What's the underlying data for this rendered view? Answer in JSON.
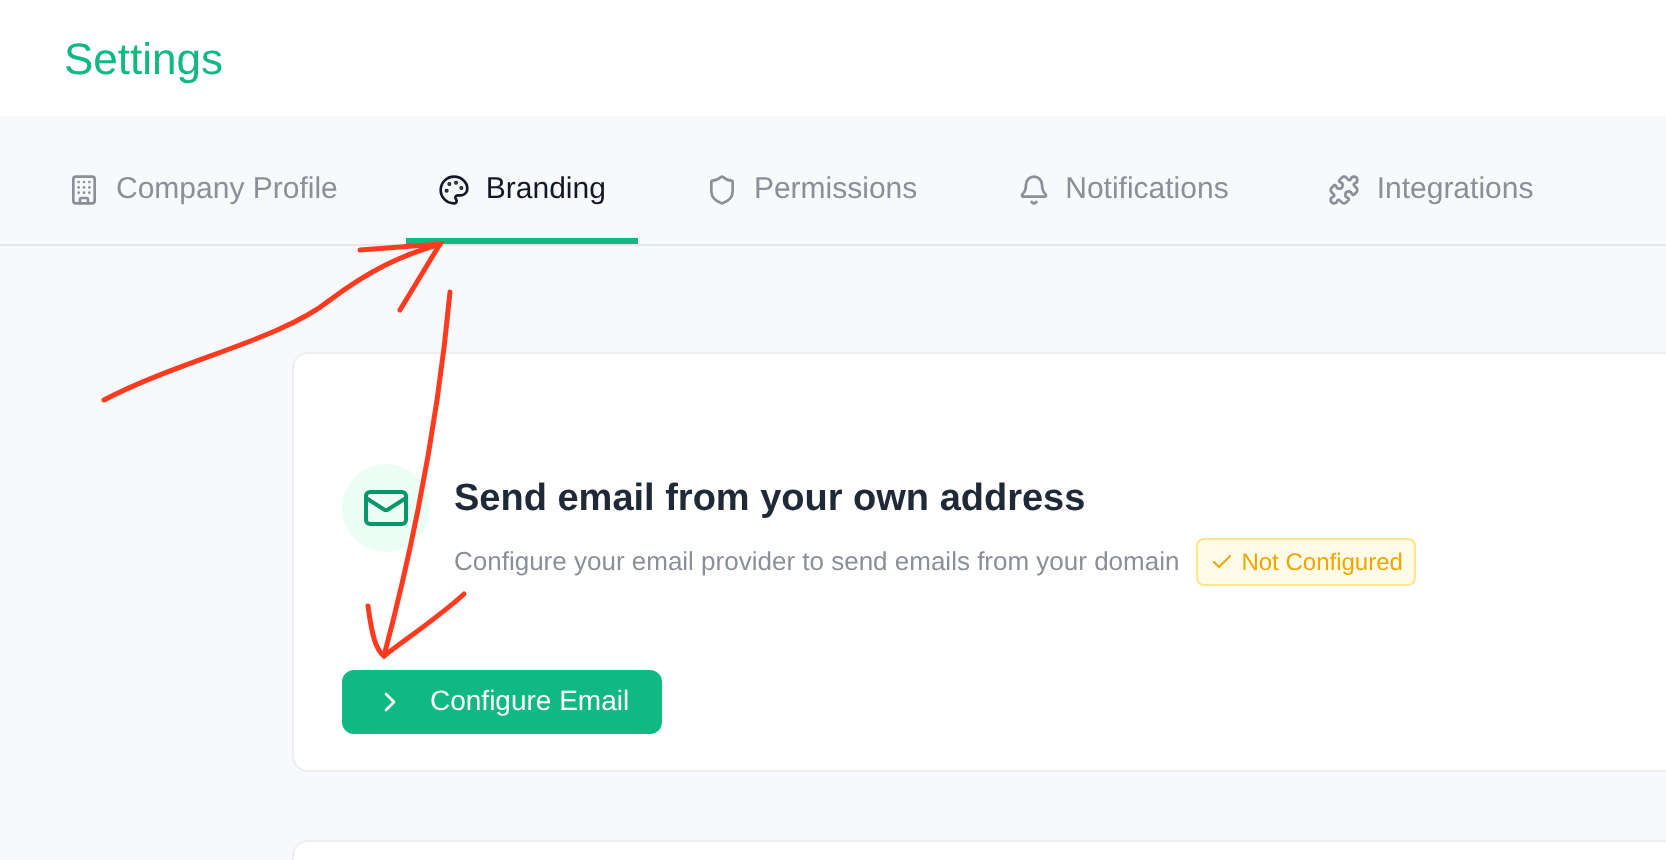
{
  "page_title": "Settings",
  "tabs": [
    {
      "label": "Company Profile",
      "selected": false
    },
    {
      "label": "Branding",
      "selected": true
    },
    {
      "label": "Permissions",
      "selected": false
    },
    {
      "label": "Notifications",
      "selected": false
    },
    {
      "label": "Integrations",
      "selected": false
    }
  ],
  "email_card": {
    "title": "Send email from your own address",
    "description": "Configure your email provider to send emails from your domain",
    "status": {
      "label": "Not Configured",
      "kind": "warning"
    },
    "button": "Configure Email"
  }
}
